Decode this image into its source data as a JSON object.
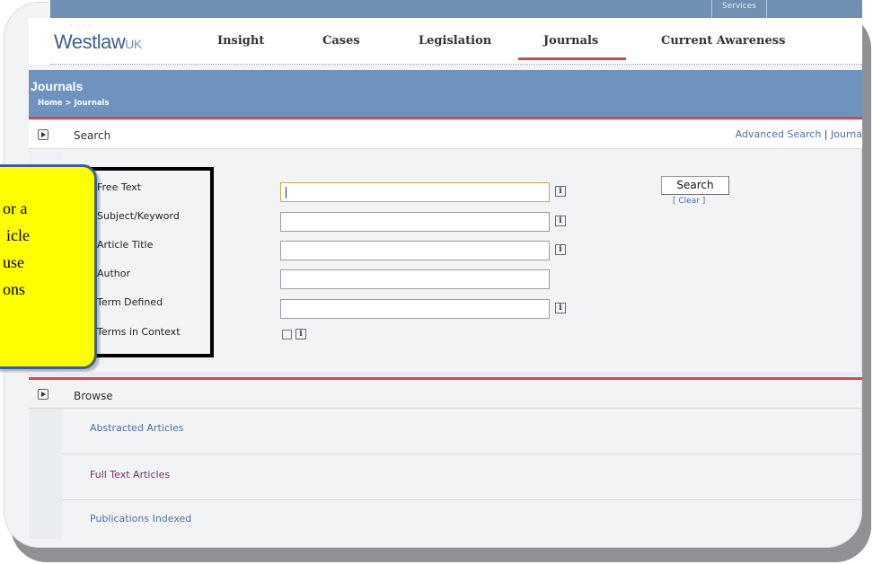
{
  "top_strip": {
    "services_label": "Services"
  },
  "header": {
    "logo_text": "Westlaw",
    "logo_suffix": "UK",
    "nav": [
      "Insight",
      "Cases",
      "Legislation",
      "Journals",
      "Current Awareness"
    ],
    "active_tab": "Journals"
  },
  "banner": {
    "title": "Journals",
    "breadcrumb": "Home > Journals"
  },
  "search": {
    "section_title": "Search",
    "links": [
      "Advanced Search",
      "Journa"
    ],
    "fields": [
      {
        "label": "Free Text",
        "value": "",
        "has_info": true,
        "type": "text"
      },
      {
        "label": "Subject/Keyword",
        "value": "",
        "has_info": true,
        "type": "text"
      },
      {
        "label": "Article Title",
        "value": "",
        "has_info": true,
        "type": "text"
      },
      {
        "label": "Author",
        "value": "",
        "has_info": false,
        "type": "text"
      },
      {
        "label": "Term Defined",
        "value": "",
        "has_info": true,
        "type": "text"
      },
      {
        "label": "Terms in Context",
        "value": false,
        "has_info": true,
        "type": "checkbox"
      }
    ],
    "search_button": "Search",
    "clear_link": "[ Clear ]",
    "info_glyph": "i"
  },
  "callout": {
    "lines": [
      "or a",
      "icle",
      "use",
      "ons"
    ],
    "color": "#ffff00",
    "border_color": "#3b5ea2"
  },
  "browse": {
    "section_title": "Browse",
    "items": [
      {
        "label": "Abstracted Articles",
        "color": "#4a6fa5"
      },
      {
        "label": "Full Text Articles",
        "color": "#7b2d6e"
      },
      {
        "label": "Publications Indexed",
        "color": "#4a6fa5"
      }
    ]
  },
  "colors": {
    "banner_blue": "#6e93bf",
    "accent_red": "#d04b4b",
    "link_blue": "#4a6fa5"
  }
}
